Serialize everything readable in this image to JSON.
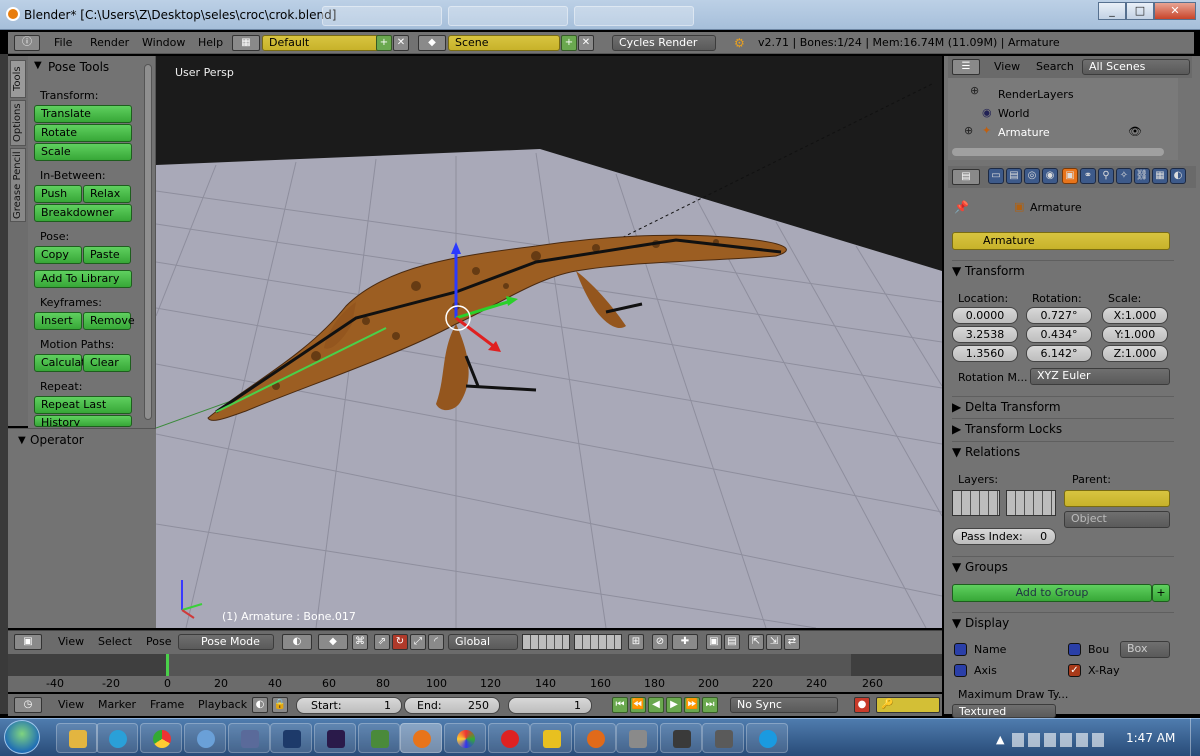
{
  "window": {
    "title": "Blender* [C:\\Users\\Z\\Desktop\\seles\\croc\\crok.blend]",
    "min": "_",
    "max": "□",
    "close": "✕"
  },
  "topbar": {
    "menus": [
      "File",
      "Render",
      "Window",
      "Help"
    ],
    "layout": "Default",
    "scene": "Scene",
    "engine": "Cycles Render",
    "status": "v2.71 | Bones:1/24 | Mem:16.74M (11.09M) | Armature"
  },
  "tooltabs": [
    "Tools",
    "Options",
    "Grease Pencil"
  ],
  "tools": {
    "title": "Pose Tools",
    "transform_label": "Transform:",
    "translate": "Translate",
    "rotate": "Rotate",
    "scale": "Scale",
    "inbetween_label": "In-Between:",
    "push": "Push",
    "relax": "Relax",
    "breakdowner": "Breakdowner",
    "pose_label": "Pose:",
    "copy": "Copy",
    "paste": "Paste",
    "add_library": "Add To Library",
    "keyframes_label": "Keyframes:",
    "insert": "Insert",
    "remove": "Remove",
    "motion_label": "Motion Paths:",
    "calculate": "Calculat",
    "clear": "Clear",
    "repeat_label": "Repeat:",
    "repeat_last": "Repeat Last",
    "history": "History",
    "operator": "Operator"
  },
  "viewport": {
    "label": "User Persp",
    "footer": "(1) Armature : Bone.017"
  },
  "outliner": {
    "view": "View",
    "search": "Search",
    "filter": "All Scenes",
    "items": [
      "RenderLayers",
      "World",
      "Armature"
    ]
  },
  "props": {
    "breadcrumb": "Armature",
    "name": "Armature",
    "transform": "Transform",
    "location_label": "Location:",
    "rotation_label": "Rotation:",
    "scale_label": "Scale:",
    "loc": [
      "0.0000",
      "3.2538",
      "1.3560"
    ],
    "rot": [
      "0.727°",
      "0.434°",
      "6.142°"
    ],
    "scl": [
      "X:1.000",
      "Y:1.000",
      "Z:1.000"
    ],
    "rotmode_label": "Rotation M...",
    "rotmode": "XYZ Euler",
    "delta": "Delta Transform",
    "locks": "Transform Locks",
    "relations": "Relations",
    "layers_label": "Layers:",
    "parent_label": "Parent:",
    "parent_type": "Object",
    "pass_index": "Pass Index:",
    "pass_value": "0",
    "groups": "Groups",
    "add_group": "Add to Group",
    "display": "Display",
    "disp_name": "Name",
    "disp_bou": "Bou",
    "disp_box": "Box",
    "disp_axis": "Axis",
    "disp_xray": "X-Ray",
    "max_draw": "Maximum Draw Ty...",
    "textured": "Textured"
  },
  "viewheader": {
    "view": "View",
    "select": "Select",
    "pose": "Pose",
    "mode": "Pose Mode",
    "orientation": "Global"
  },
  "timeline": {
    "ticks": [
      "-40",
      "-20",
      "0",
      "20",
      "40",
      "60",
      "80",
      "100",
      "120",
      "140",
      "160",
      "180",
      "200",
      "220",
      "240",
      "260"
    ],
    "view": "View",
    "marker": "Marker",
    "frame": "Frame",
    "playback": "Playback",
    "start_label": "Start:",
    "start": "1",
    "end_label": "End:",
    "end": "250",
    "current": "1",
    "sync": "No Sync"
  },
  "taskbar": {
    "clock": "1:47 AM"
  },
  "colors": {
    "green_button": "#3fb43f",
    "yellow_field": "#d3bf36",
    "grid_floor": "#a9a9b8",
    "background": "#1b1b1b"
  }
}
